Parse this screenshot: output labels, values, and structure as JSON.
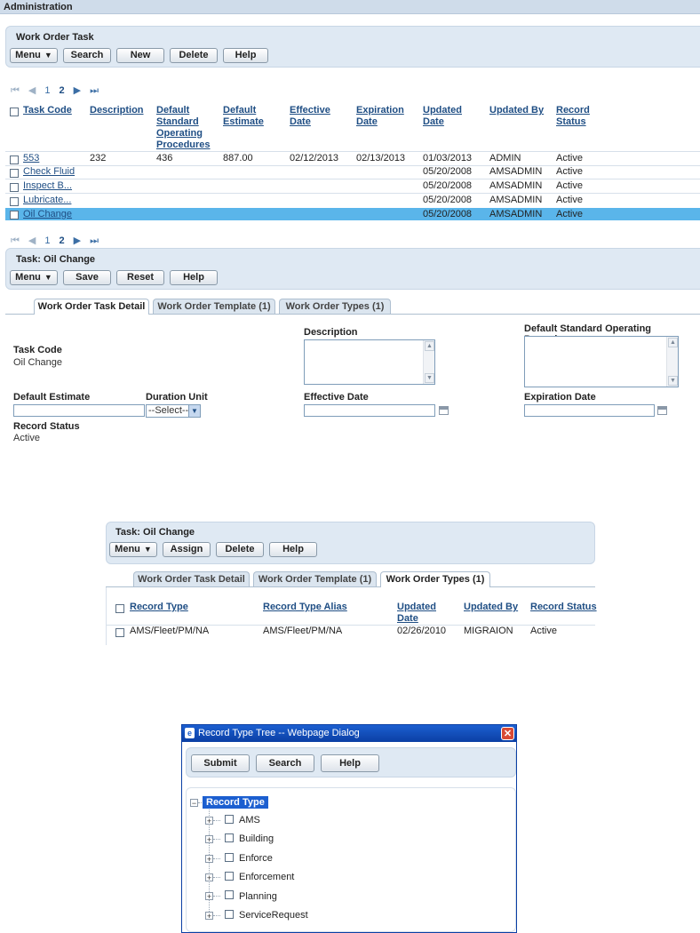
{
  "page_header": "Administration",
  "panel1": {
    "title": "Work Order Task",
    "buttons": {
      "menu": "Menu",
      "search": "Search",
      "new": "New",
      "delete": "Delete",
      "help": "Help"
    }
  },
  "pager": {
    "first": "⏮",
    "prev": "◀",
    "page1": "1",
    "page2": "2",
    "next": "▶",
    "last": "⏭"
  },
  "task_table": {
    "headers": [
      "Task Code",
      "Description",
      "Default Standard Operating Procedures",
      "Default Estimate",
      "Effective Date",
      "Expiration Date",
      "Updated Date",
      "Updated By",
      "Record Status"
    ],
    "header_lines": {
      "dsop": [
        "Default",
        "Standard",
        "Operating",
        "Procedures"
      ],
      "de": [
        "Default",
        "Estimate"
      ],
      "eff": [
        "Effective",
        "Date"
      ],
      "exp": [
        "Expiration",
        "Date"
      ],
      "upd": [
        "Updated",
        "Date"
      ],
      "rs": [
        "Record",
        "Status"
      ]
    },
    "rows": [
      {
        "code": "553",
        "description": "232",
        "dsop": "436",
        "estimate": "887.00",
        "effective": "02/12/2013",
        "expiration": "02/13/2013",
        "updated": "01/03/2013",
        "by": "ADMIN",
        "status": "Active"
      },
      {
        "code": "Check Fluid",
        "description": "",
        "dsop": "",
        "estimate": "",
        "effective": "",
        "expiration": "",
        "updated": "05/20/2008",
        "by": "AMSADMIN",
        "status": "Active"
      },
      {
        "code": "Inspect B...",
        "description": "",
        "dsop": "",
        "estimate": "",
        "effective": "",
        "expiration": "",
        "updated": "05/20/2008",
        "by": "AMSADMIN",
        "status": "Active"
      },
      {
        "code": "Lubricate...",
        "description": "",
        "dsop": "",
        "estimate": "",
        "effective": "",
        "expiration": "",
        "updated": "05/20/2008",
        "by": "AMSADMIN",
        "status": "Active"
      },
      {
        "code": "Oil Change",
        "description": "",
        "dsop": "",
        "estimate": "",
        "effective": "",
        "expiration": "",
        "updated": "05/20/2008",
        "by": "AMSADMIN",
        "status": "Active"
      }
    ],
    "selected_row": "Oil Change"
  },
  "panel2": {
    "title": "Task: Oil Change",
    "buttons": {
      "menu": "Menu",
      "save": "Save",
      "reset": "Reset",
      "help": "Help"
    }
  },
  "tabs": [
    "Work Order Task Detail",
    "Work Order Template (1)",
    "Work Order Types (1)"
  ],
  "detail_form": {
    "task_code_label": "Task Code",
    "task_code_value": "Oil Change",
    "description_label": "Description",
    "dsop_label": "Default Standard Operating Procedures",
    "default_estimate_label": "Default Estimate",
    "duration_unit_label": "Duration Unit",
    "duration_unit_value": "--Select--",
    "effective_date_label": "Effective Date",
    "expiration_date_label": "Expiration Date",
    "record_status_label": "Record Status",
    "record_status_value": "Active"
  },
  "panel3": {
    "title": "Task: Oil Change",
    "buttons": {
      "menu": "Menu",
      "assign": "Assign",
      "delete": "Delete",
      "help": "Help"
    }
  },
  "types_table": {
    "headers": {
      "record_type": "Record Type",
      "alias": "Record Type Alias",
      "updated_line1": "Updated",
      "updated_line2": "Date",
      "updated_by": "Updated By",
      "status": "Record Status"
    },
    "rows": [
      {
        "record_type": "AMS/Fleet/PM/NA",
        "alias": "AMS/Fleet/PM/NA",
        "updated": "02/26/2010",
        "by": "MIGRAION",
        "status": "Active"
      }
    ]
  },
  "dialog": {
    "title": "Record Type Tree -- Webpage Dialog",
    "buttons": {
      "submit": "Submit",
      "search": "Search",
      "help": "Help"
    },
    "tree_root": "Record Type",
    "tree_items": [
      "AMS",
      "Building",
      "Enforce",
      "Enforcement",
      "Planning",
      "ServiceRequest"
    ]
  },
  "colors": {
    "panel_bg": "#dfe9f3",
    "selected_row": "#5ab5ea",
    "link": "#1f4e84",
    "dialog_title": "#0b3fa4"
  }
}
